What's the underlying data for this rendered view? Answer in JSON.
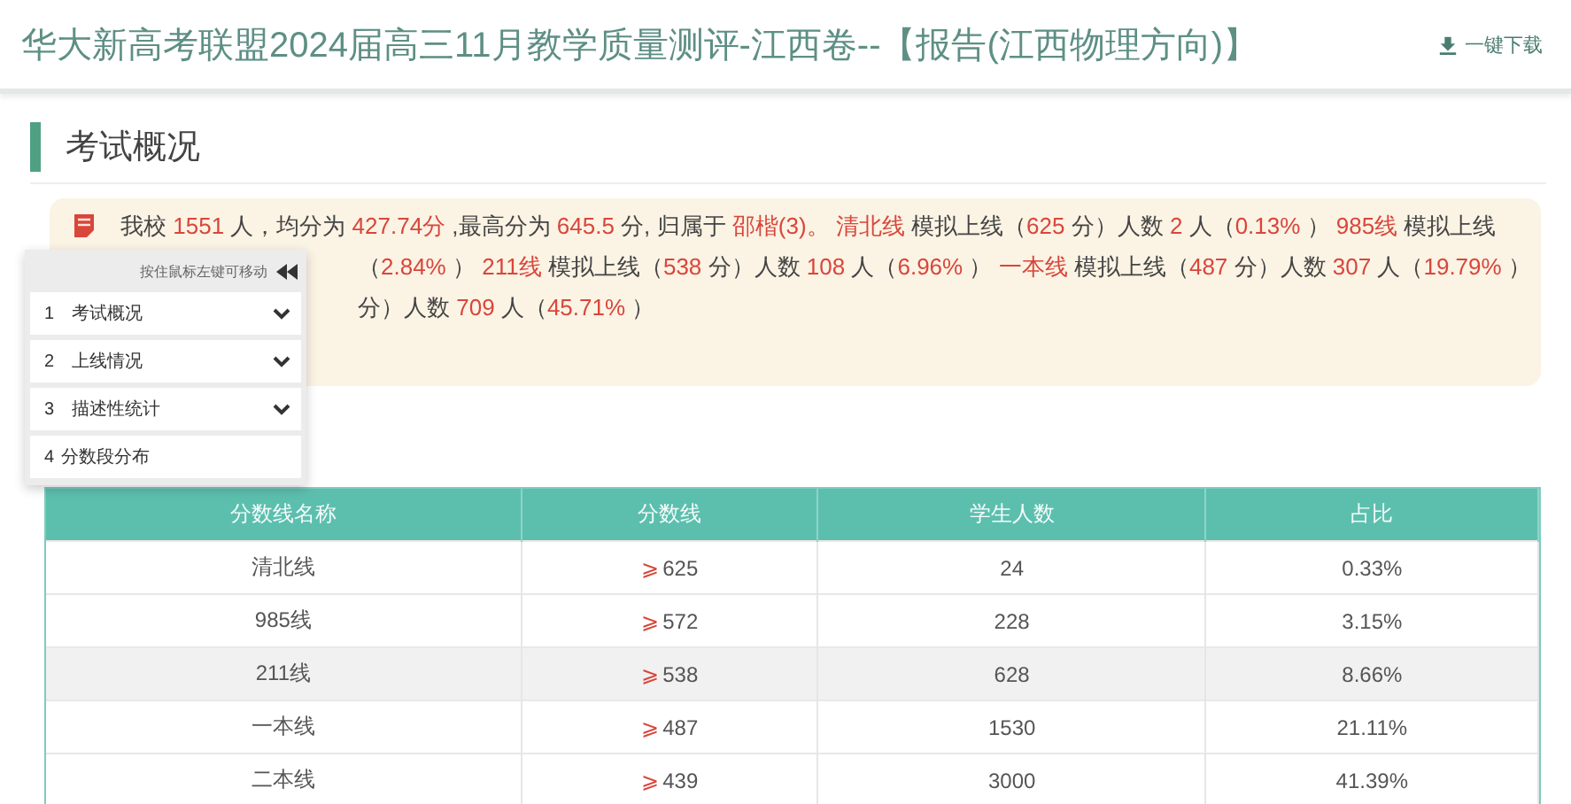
{
  "header": {
    "title": "华大新高考联盟2024届高三11月教学质量测评-江西卷--【报告(江西物理方向)】",
    "download": "一键下载"
  },
  "section": {
    "title": "考试概况"
  },
  "summary": {
    "lines": [
      [
        {
          "text": "我校 "
        },
        {
          "text": "1551",
          "highlight": true
        },
        {
          "text": " 人，均分为 "
        },
        {
          "text": "427.74分",
          "highlight": true
        },
        {
          "text": " ,最高分为 "
        },
        {
          "text": "645.5",
          "highlight": true
        },
        {
          "text": " 分, 归属于 "
        },
        {
          "text": "邵楷(3)。 ",
          "highlight": true
        },
        {
          "text": "清北线",
          "highlight": true
        },
        {
          "text": " 模拟上线（"
        },
        {
          "text": "625",
          "highlight": true
        },
        {
          "text": " 分）人数 "
        },
        {
          "text": "2",
          "highlight": true
        },
        {
          "text": " 人（"
        },
        {
          "text": "0.13%",
          "highlight": true
        },
        {
          "text": " ） "
        },
        {
          "text": "985线",
          "highlight": true
        },
        {
          "text": " 模拟上线"
        }
      ],
      [
        {
          "text": "（"
        },
        {
          "text": "2.84%",
          "highlight": true
        },
        {
          "text": " ） "
        },
        {
          "text": "211线",
          "highlight": true
        },
        {
          "text": " 模拟上线（"
        },
        {
          "text": "538",
          "highlight": true
        },
        {
          "text": " 分）人数 "
        },
        {
          "text": "108",
          "highlight": true
        },
        {
          "text": " 人（"
        },
        {
          "text": "6.96%",
          "highlight": true
        },
        {
          "text": " ） "
        },
        {
          "text": "一本线",
          "highlight": true
        },
        {
          "text": " 模拟上线（"
        },
        {
          "text": "487",
          "highlight": true
        },
        {
          "text": " 分）人数 "
        },
        {
          "text": "307",
          "highlight": true
        },
        {
          "text": " 人（"
        },
        {
          "text": "19.79%",
          "highlight": true
        },
        {
          "text": " ）"
        }
      ],
      [
        {
          "text": "分）人数 "
        },
        {
          "text": "709",
          "highlight": true
        },
        {
          "text": " 人（"
        },
        {
          "text": "45.71%",
          "highlight": true
        },
        {
          "text": " ）"
        }
      ]
    ]
  },
  "nav_panel": {
    "hint": "按住鼠标左键可移动",
    "items": [
      {
        "number": "1",
        "label": "考试概况",
        "expandable": true
      },
      {
        "number": "2",
        "label": "上线情况",
        "expandable": true
      },
      {
        "number": "3",
        "label": "描述性统计",
        "expandable": true
      },
      {
        "number": "4",
        "label": "分数段分布",
        "expandable": false
      }
    ]
  },
  "table": {
    "columns": [
      "分数线名称",
      "分数线",
      "学生人数",
      "占比"
    ],
    "rows": [
      {
        "name": "清北线",
        "symbol": "⩾",
        "score": "625",
        "count": "24",
        "ratio": "0.33%",
        "highlighted": false
      },
      {
        "name": "985线",
        "symbol": "⩾",
        "score": "572",
        "count": "228",
        "ratio": "3.15%",
        "highlighted": false
      },
      {
        "name": "211线",
        "symbol": "⩾",
        "score": "538",
        "count": "628",
        "ratio": "8.66%",
        "highlighted": true
      },
      {
        "name": "一本线",
        "symbol": "⩾",
        "score": "487",
        "count": "1530",
        "ratio": "21.11%",
        "highlighted": false
      },
      {
        "name": "二本线",
        "symbol": "⩾",
        "score": "439",
        "count": "3000",
        "ratio": "41.39%",
        "highlighted": false
      }
    ]
  }
}
